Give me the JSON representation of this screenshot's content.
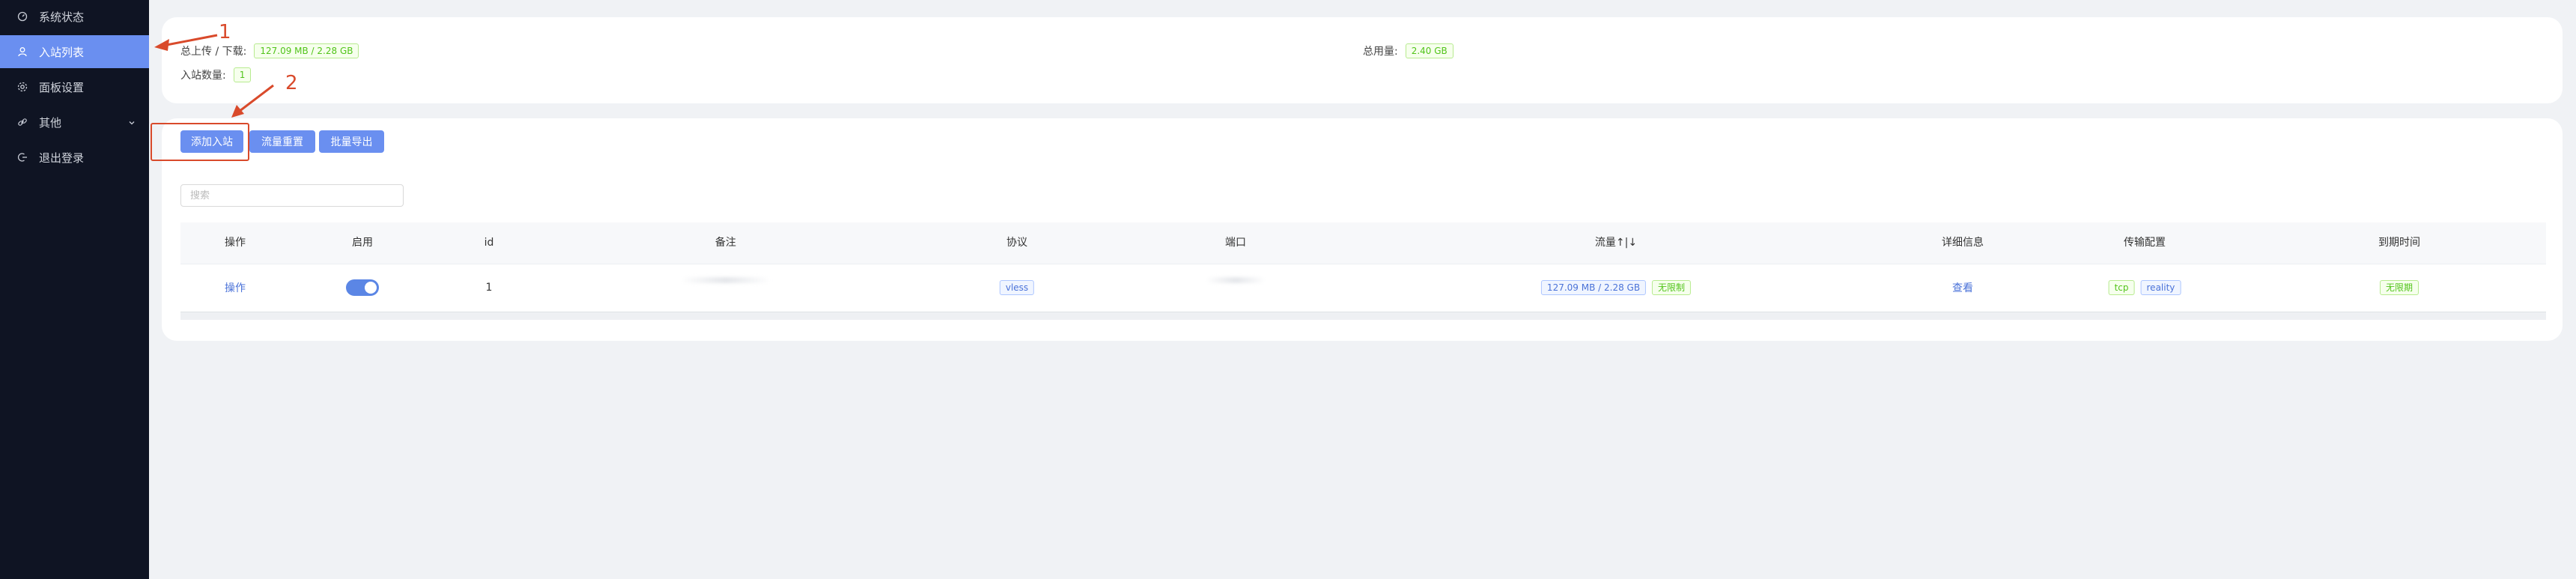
{
  "sidebar": {
    "items": [
      {
        "label": "系统状态",
        "icon": "dashboard-icon",
        "active": false
      },
      {
        "label": "入站列表",
        "icon": "user-icon",
        "active": true
      },
      {
        "label": "面板设置",
        "icon": "gear-icon",
        "active": false
      },
      {
        "label": "其他",
        "icon": "link-icon",
        "active": false,
        "has_submenu": true
      },
      {
        "label": "退出登录",
        "icon": "logout-icon",
        "active": false
      }
    ]
  },
  "stats": {
    "updown_label": "总上传 / 下载:",
    "updown_value": "127.09 MB / 2.28 GB",
    "total_label": "总用量:",
    "total_value": "2.40 GB",
    "count_label": "入站数量:",
    "count_value": "1"
  },
  "toolbar": {
    "add_label": "添加入站",
    "reset_label": "流量重置",
    "export_label": "批量导出"
  },
  "search": {
    "placeholder": "搜索",
    "value": ""
  },
  "table": {
    "headers": [
      "操作",
      "启用",
      "id",
      "备注",
      "协议",
      "端口",
      "流量↑|↓",
      "详细信息",
      "传输配置",
      "到期时间"
    ],
    "rows": [
      {
        "action": "操作",
        "enabled": true,
        "id": "1",
        "remark": "",
        "protocol": "vless",
        "port": "",
        "traffic": "127.09 MB / 2.28 GB",
        "traffic_limit": "无限制",
        "details": "查看",
        "transport": [
          "tcp",
          "reality"
        ],
        "expiry": "无限期"
      }
    ]
  },
  "annotations": {
    "step1": "1",
    "step2": "2"
  },
  "colors": {
    "accent": "#6a8ff0",
    "sidebar_bg": "#0f1423",
    "annotation": "#d94a2b"
  }
}
